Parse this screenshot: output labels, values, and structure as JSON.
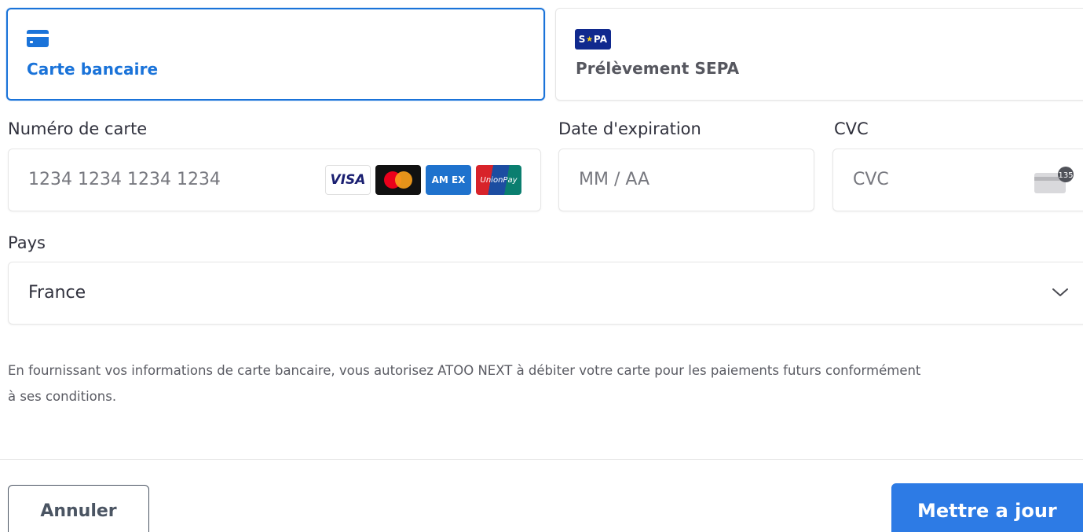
{
  "payment_methods": {
    "card": {
      "label": "Carte bancaire",
      "icon": "credit-card-icon",
      "selected": true
    },
    "sepa": {
      "label": "Prélèvement SEPA",
      "icon": "sepa-logo-icon",
      "badge_text_left": "S",
      "badge_text_right": "PA",
      "selected": false
    }
  },
  "form": {
    "card_number": {
      "label": "Numéro de carte",
      "placeholder": "1234 1234 1234 1234"
    },
    "card_brands": {
      "visa": "VISA",
      "amex": "AM EX",
      "unionpay": "UnionPay"
    },
    "expiry": {
      "label": "Date d'expiration",
      "placeholder": "MM / AA"
    },
    "cvc": {
      "label": "CVC",
      "placeholder": "CVC",
      "icon_number": "135"
    },
    "country": {
      "label": "Pays",
      "value": "France"
    }
  },
  "legal": {
    "line1": "En fournissant vos informations de carte bancaire, vous autorisez ATOO NEXT à débiter votre carte pour les paiements futurs conformément",
    "line2": "à ses conditions."
  },
  "actions": {
    "cancel_label": "Annuler",
    "update_label": "Mettre a jour"
  },
  "colors": {
    "accent": "#1a73d9",
    "primary_button": "#2d7be5",
    "sepa_blue": "#10298e"
  }
}
